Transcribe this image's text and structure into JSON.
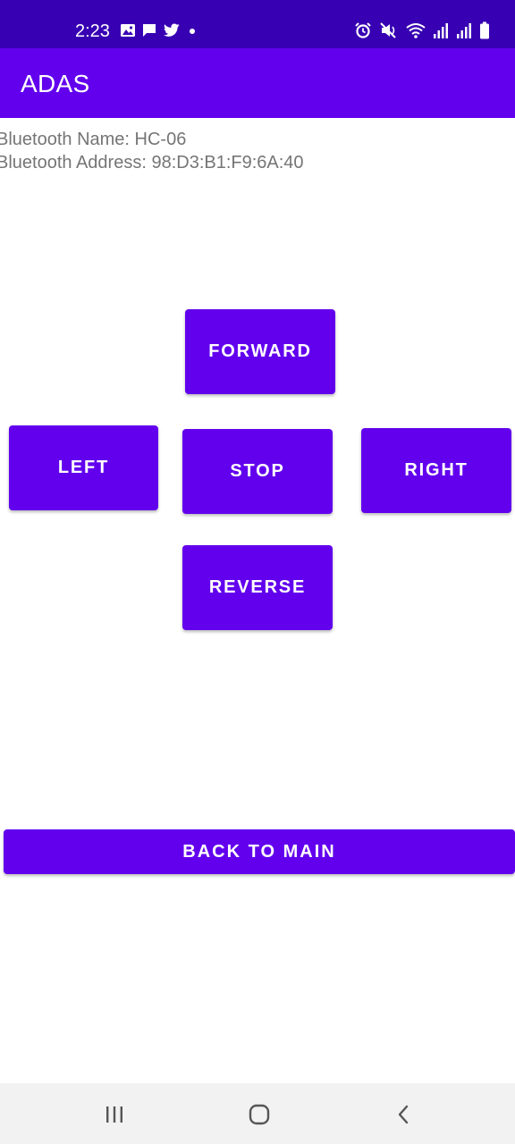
{
  "status_bar": {
    "time": "2:23",
    "left_icons": [
      "image-icon",
      "message-icon",
      "twitter-icon",
      "dot-icon"
    ],
    "right_icons": [
      "alarm-icon",
      "mute-icon",
      "wifi-icon",
      "signal-icon",
      "signal-icon-2",
      "battery-icon"
    ]
  },
  "app_bar": {
    "title": "ADAS"
  },
  "device_info": {
    "name_line": "Bluetooth Name: HC-06",
    "address_line": "Bluetooth Address: 98:D3:B1:F9:6A:40"
  },
  "controls": {
    "forward_label": "FORWARD",
    "left_label": "LEFT",
    "stop_label": "STOP",
    "right_label": "RIGHT",
    "reverse_label": "REVERSE",
    "back_label": "BACK TO MAIN"
  },
  "colors": {
    "status_bar": "#3700b3",
    "primary": "#6200ee",
    "info_text": "#757575",
    "nav_bar": "#f2f2f2"
  },
  "nav_bar": {
    "icons": [
      "recents-icon",
      "home-icon",
      "back-icon"
    ]
  }
}
